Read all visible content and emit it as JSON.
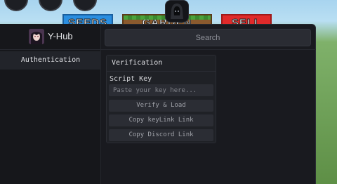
{
  "game": {
    "seeds_label": "SEEDS",
    "garden_label": "GARDEN",
    "sell_label": "SELL"
  },
  "hub": {
    "title": "Y-Hub",
    "search_placeholder": "Search",
    "tabs": [
      {
        "label": "Authentication"
      }
    ],
    "verification": {
      "title": "Verification",
      "script_key_label": "Script Key",
      "key_placeholder": "Paste your key here...",
      "verify_button": "Verify & Load",
      "copy_key_link_button": "Copy keyLink Link",
      "copy_discord_button": "Copy Discord Link"
    }
  }
}
